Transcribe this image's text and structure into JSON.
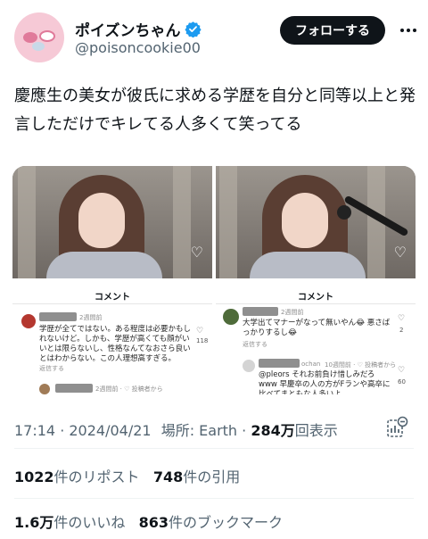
{
  "user": {
    "display_name": "ポイズンちゃん",
    "handle": "@poisoncookie00",
    "verified": true,
    "follow_label": "フォローする"
  },
  "tweet": {
    "text": "慶應生の美女が彼氏に求める学歴を自分と同等以上と発言しただけでキレてる人多くて笑ってる"
  },
  "media": {
    "left": {
      "comment_header": "コメント",
      "comments": [
        {
          "meta": "2週間前",
          "text": "学歴が全てではない。ある程度は必要かもしれないけど。しかも、学歴が高くても顔がいいとは限らないし、性格なんてなおさら良いとはわからない。この人理想高すぎる。",
          "reply": "返信する",
          "likes": "118"
        },
        {
          "meta": "2週間前 · ♡ 投稿者から"
        }
      ]
    },
    "right": {
      "comment_header": "コメント",
      "comments": [
        {
          "meta": "2週間前",
          "text": "大学出てマナーがなって無いやん😂 悪さばっかりするし😂",
          "reply": "返信する",
          "likes": "2"
        },
        {
          "user_suffix": "ochan",
          "meta": "10週間前 · ♡ 投稿者から",
          "text": "@pleors それお前負け惜しみだろ www 早慶卒の人の方がFランや高卒に比べてまともな人多いよ",
          "likes": "60"
        }
      ]
    }
  },
  "meta": {
    "time": "17:14",
    "date": "2024/04/21",
    "location_label": "場所: Earth",
    "views_number": "284万",
    "views_label": "回表示"
  },
  "stats": {
    "reposts_number": "1022",
    "reposts_label": "件のリポスト",
    "quotes_number": "748",
    "quotes_label": "件の引用",
    "likes_number": "1.6万",
    "likes_label": "件のいいね",
    "bookmarks_number": "863",
    "bookmarks_label": "件のブックマーク"
  },
  "colors": {
    "verified": "#1d9bf0",
    "follow_bg": "#0f1419",
    "secondary_text": "#536471"
  }
}
